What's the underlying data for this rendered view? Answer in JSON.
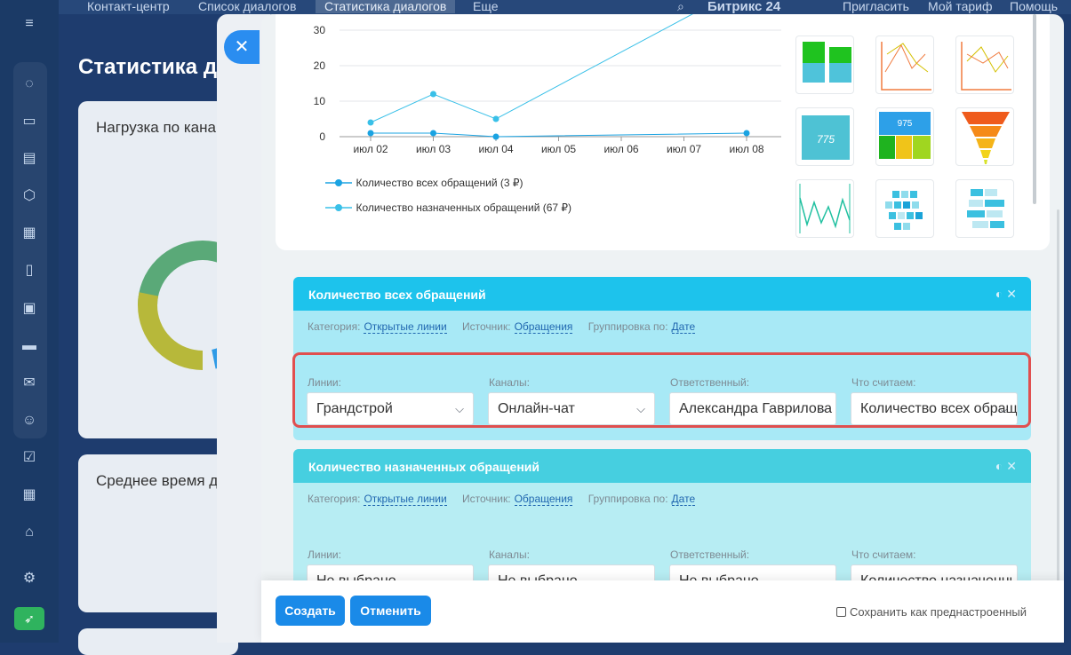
{
  "topnav": {
    "items": [
      "Контакт-центр",
      "Список диалогов",
      "Статистика диалогов",
      "Еще"
    ],
    "brand": "Битрикс 24",
    "invite": "Пригласить",
    "plan": "Мой тариф",
    "help": "Помощь"
  },
  "sidebar": {
    "icons": [
      "menu-icon",
      "connector-icon",
      "chat-icon",
      "document-icon",
      "hexagon-icon",
      "calendar-icon",
      "file-icon",
      "presentation-icon",
      "card-icon",
      "mail-icon",
      "users-icon",
      "checkbox-icon",
      "calendar-grid-icon",
      "bank-icon",
      "settings-icon",
      "rocket-icon"
    ]
  },
  "background": {
    "page_title": "Статистика ди",
    "card1_title": "Нагрузка по кана",
    "card2_title": "Среднее время д"
  },
  "chart_data": {
    "type": "line",
    "categories": [
      "июл 02",
      "июл 03",
      "июл 04",
      "июл 05",
      "июл 06",
      "июл 07",
      "июл 08"
    ],
    "y_ticks": [
      0,
      10,
      20,
      30
    ],
    "ylim": [
      0,
      35
    ],
    "series": [
      {
        "name": "Количество всех обращений (3 ₽)",
        "values": [
          4,
          12,
          5,
          null,
          null,
          null,
          null
        ]
      },
      {
        "name": "Количество назначенных обращений (67 ₽)",
        "values": [
          1,
          1,
          0,
          null,
          null,
          null,
          1
        ]
      }
    ],
    "colors": [
      "#39c0e8",
      "#1aa3e2"
    ]
  },
  "widgets": [
    {
      "title": "Количество всех обращений",
      "category_label": "Категория:",
      "category_value": "Открытые линии",
      "source_label": "Источник:",
      "source_value": "Обращения",
      "group_label": "Группировка по:",
      "group_value": "Дате",
      "fields": [
        {
          "label": "Линии:",
          "value": "Грандстрой"
        },
        {
          "label": "Каналы:",
          "value": "Онлайн-чат"
        },
        {
          "label": "Ответственный:",
          "value": "Александра Гаврилова"
        },
        {
          "label": "Что считаем:",
          "value": "Количество всех обращений"
        }
      ]
    },
    {
      "title": "Количество назначенных обращений",
      "category_label": "Категория:",
      "category_value": "Открытые линии",
      "source_label": "Источник:",
      "source_value": "Обращения",
      "group_label": "Группировка по:",
      "group_value": "Дате",
      "fields": [
        {
          "label": "Линии:",
          "value": "Не выбрано"
        },
        {
          "label": "Каналы:",
          "value": "Не выбрано"
        },
        {
          "label": "Ответственный:",
          "value": "Не выбрано"
        },
        {
          "label": "Что считаем:",
          "value": "Количество назначенных обращений"
        }
      ]
    }
  ],
  "thumbnails": {
    "kpi_number": "775",
    "mixed_number": "975"
  },
  "footer": {
    "create": "Создать",
    "cancel": "Отменить",
    "save_preset": "Сохранить как преднастроенный"
  }
}
